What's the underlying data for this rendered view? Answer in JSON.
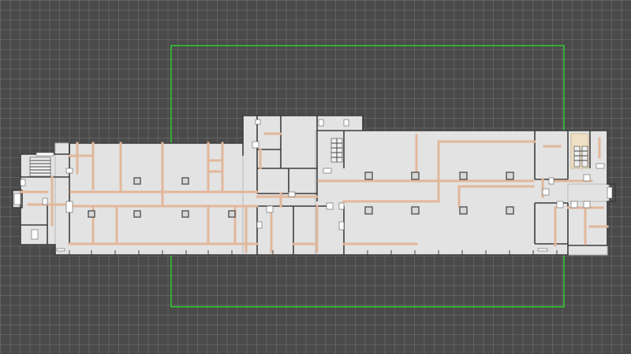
{
  "viewport": {
    "background": "#4a4a4a",
    "grid_color": "#5a5a5a",
    "selection_color": "#2bd62b"
  },
  "floor_plan": {
    "wall_color": "#3c3c3c",
    "floor_color": "#e3e3e3",
    "pipe_color": "#e2b79b",
    "stair_highlight_color": "#efe0c4",
    "icon": "floor-plan-drawing"
  }
}
